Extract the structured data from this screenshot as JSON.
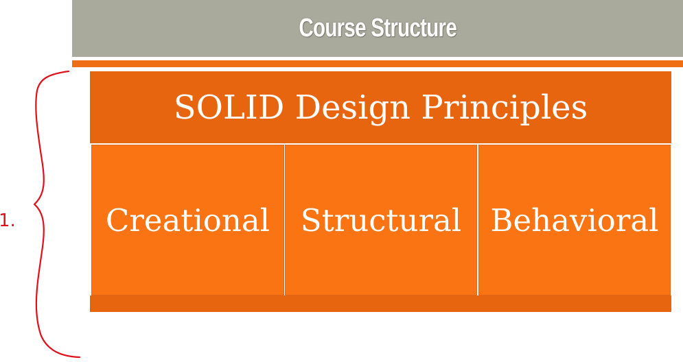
{
  "header": {
    "title": "Course Structure"
  },
  "diagram": {
    "top_label": "SOLID Design Principles",
    "categories": [
      {
        "label": "Creational"
      },
      {
        "label": "Structural"
      },
      {
        "label": "Behavioral"
      }
    ]
  },
  "annotation": {
    "margin_mark": "1."
  },
  "colors": {
    "title_bar": "#aaaa9c",
    "accent": "#ef6d13",
    "orange_dark": "#e8650f",
    "orange_light": "#fb7413",
    "ink": "#e0101a"
  },
  "icons": {
    "bracket": "curly-brace-icon"
  }
}
